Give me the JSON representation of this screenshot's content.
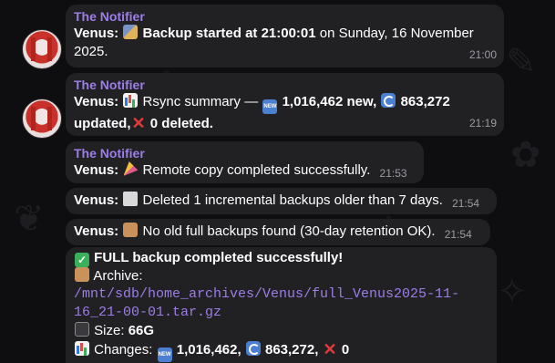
{
  "sender": "The Notifier",
  "messages": [
    {
      "host": "Venus:",
      "text_bold": "Backup started at 21:00:01",
      "text_rest": "on Sunday, 16 November 2025.",
      "time": "21:00",
      "icon": "broom-icon"
    },
    {
      "host": "Venus:",
      "t1": "Rsync summary —",
      "new_count": "1,016,462 new,",
      "updated_count": "863,272",
      "t2": "updated,",
      "deleted_count": "0 deleted.",
      "time": "21:19"
    },
    {
      "host": "Venus:",
      "text": "Remote copy completed successfully.",
      "time": "21:53"
    },
    {
      "host": "Venus:",
      "text": "Deleted 1 incremental backups older than 7 days.",
      "time": "21:54"
    },
    {
      "host": "Venus:",
      "text": "No old full backups found (30-day retention OK).",
      "time": "21:54"
    },
    {
      "title": "FULL backup completed successfully!",
      "archive_label": "Archive:",
      "archive_path_1": "/mnt/sdb/home_archives/Venus/full_Venus2025-11-",
      "archive_path_2": "16_21-00-01.tar.gz",
      "size_label": "Size:",
      "size_value": "66G",
      "changes_label": "Changes:",
      "changes_new": "1,016,462,",
      "changes_updated": "863,272,",
      "changes_deleted": "0"
    }
  ],
  "colors": {
    "background": "#0e0e10",
    "bubble": "#212124",
    "sender": "#9d7de8",
    "timestamp": "#9b9ba1"
  }
}
